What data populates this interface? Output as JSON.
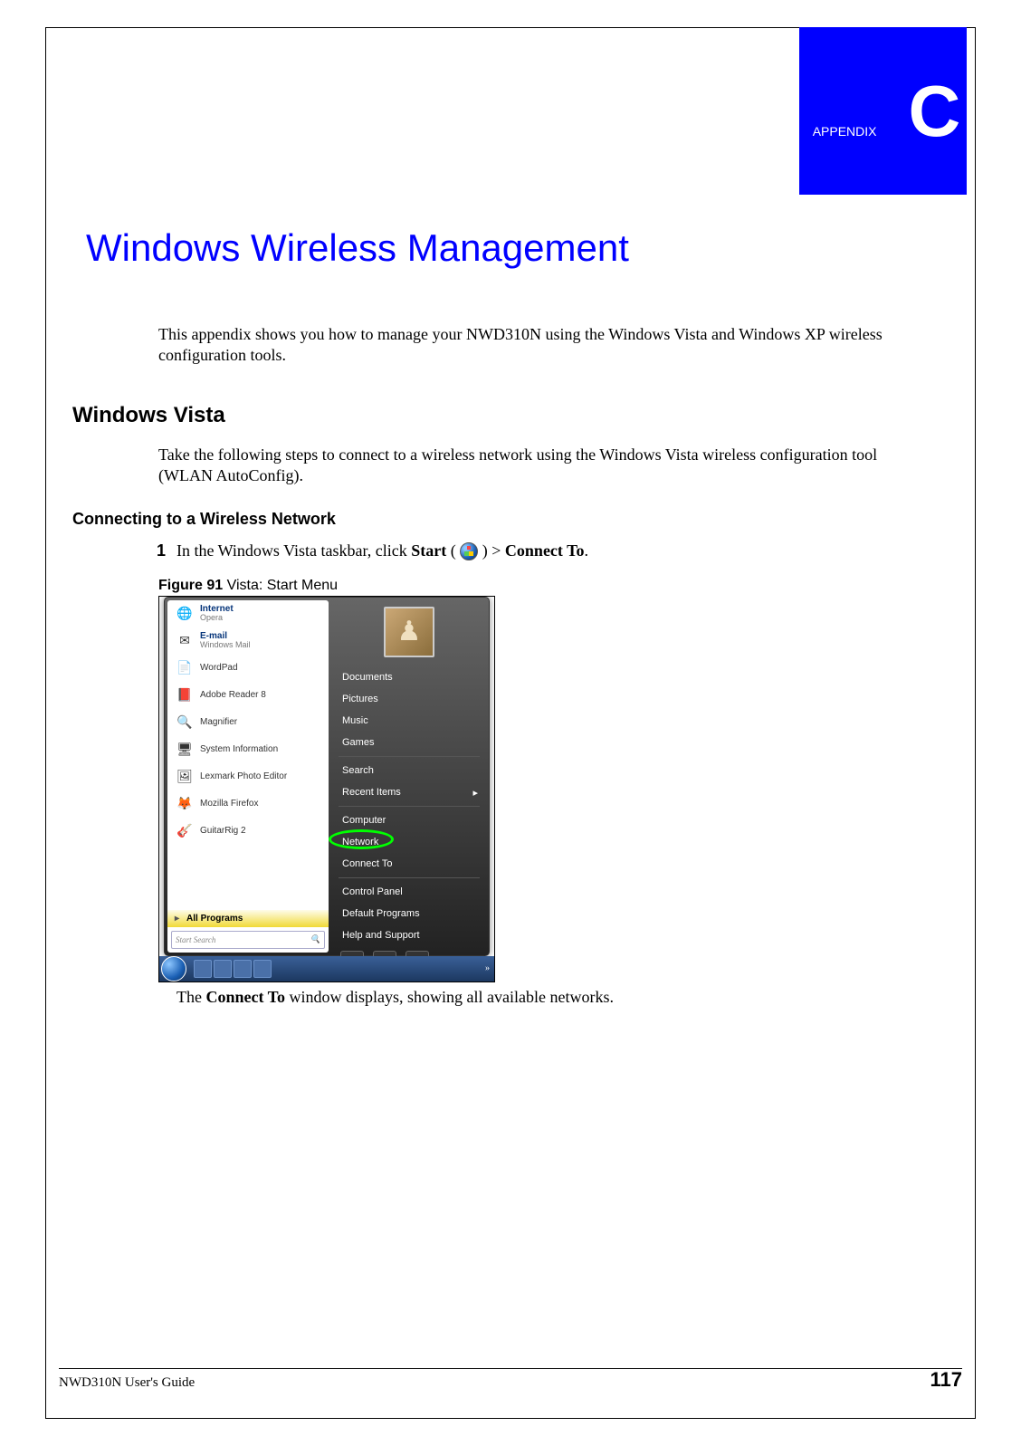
{
  "appendix": {
    "word": "APPENDIX",
    "letter": "C"
  },
  "chapter_title": "Windows Wireless Management",
  "intro": "This appendix shows you how to manage your NWD310N using the Windows Vista and Windows XP wireless configuration tools.",
  "section1": {
    "heading": "Windows Vista",
    "text": "Take the following steps to connect to a wireless network using the Windows Vista wireless configuration tool (WLAN AutoConfig)."
  },
  "subsection1": {
    "heading": "Connecting to a Wireless Network",
    "step1_num": "1",
    "step1_prefix": "In the Windows Vista taskbar, click ",
    "step1_bold1": "Start",
    "step1_paren_open": " ( ",
    "step1_paren_close": " ) > ",
    "step1_bold2": "Connect To",
    "step1_period": "."
  },
  "figure": {
    "label": "Figure 91",
    "caption": "   Vista: Start Menu",
    "left_items": [
      {
        "primary": "Internet",
        "secondary": "Opera",
        "icon": "🌐"
      },
      {
        "primary": "E-mail",
        "secondary": "Windows Mail",
        "icon": "✉"
      },
      {
        "primary": "WordPad",
        "secondary": "",
        "icon": "📄"
      },
      {
        "primary": "Adobe Reader 8",
        "secondary": "",
        "icon": "📕"
      },
      {
        "primary": "Magnifier",
        "secondary": "",
        "icon": "🔍"
      },
      {
        "primary": "System Information",
        "secondary": "",
        "icon": "🖥"
      },
      {
        "primary": "Lexmark Photo Editor",
        "secondary": "",
        "icon": "🖼"
      },
      {
        "primary": "Mozilla Firefox",
        "secondary": "",
        "icon": "🦊"
      },
      {
        "primary": "GuitarRig 2",
        "secondary": "",
        "icon": "🎸"
      }
    ],
    "all_programs": "All Programs",
    "search_placeholder": "Start Search",
    "right_items": [
      {
        "label": "Documents",
        "arrow": false
      },
      {
        "label": "Pictures",
        "arrow": false
      },
      {
        "label": "Music",
        "arrow": false
      },
      {
        "label": "Games",
        "arrow": false
      },
      {
        "label": "Search",
        "arrow": false
      },
      {
        "label": "Recent Items",
        "arrow": true
      },
      {
        "label": "Computer",
        "arrow": false
      },
      {
        "label": "Network",
        "arrow": false
      },
      {
        "label": "Connect To",
        "arrow": false
      },
      {
        "label": "Control Panel",
        "arrow": false
      },
      {
        "label": "Default Programs",
        "arrow": false
      },
      {
        "label": "Help and Support",
        "arrow": false
      }
    ],
    "search_icon": "🔍",
    "tray_arrow": "»"
  },
  "after_figure_prefix": "The ",
  "after_figure_bold": "Connect To",
  "after_figure_suffix": " window displays, showing all available networks.",
  "footer": {
    "left": "NWD310N User's Guide",
    "right": "117"
  }
}
